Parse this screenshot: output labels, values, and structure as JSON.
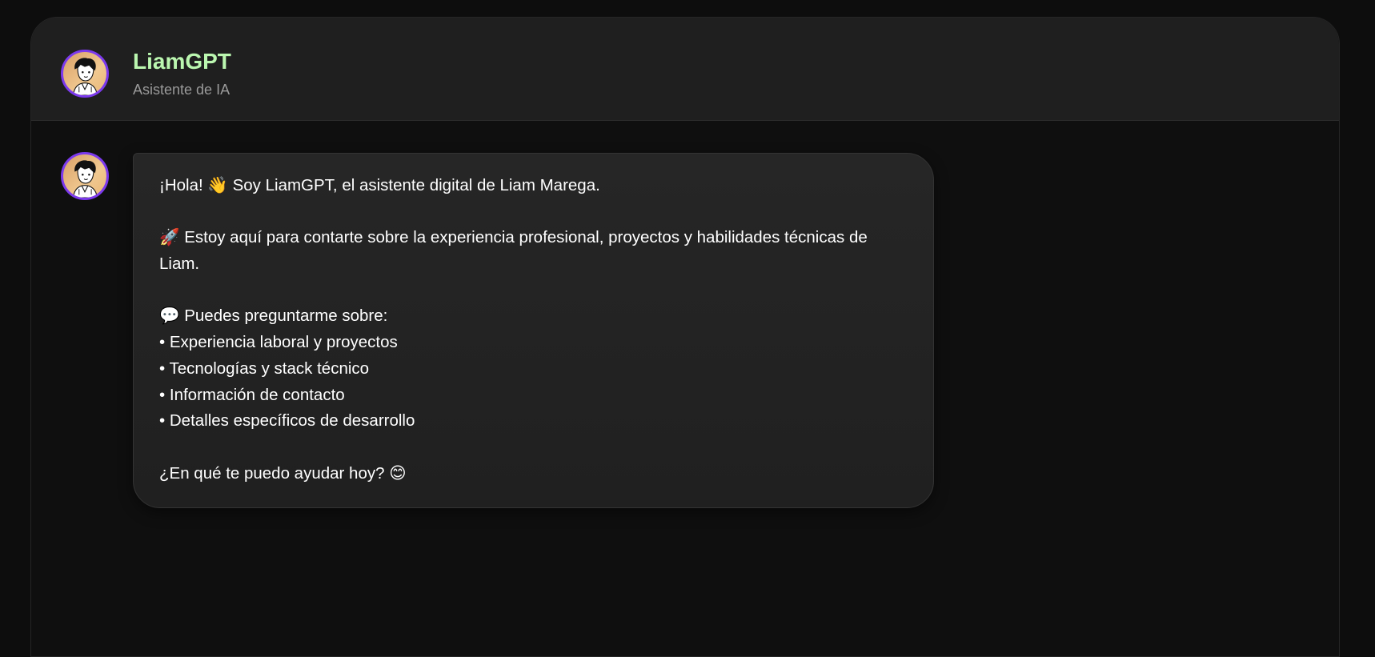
{
  "header": {
    "title": "LiamGPT",
    "subtitle": "Asistente de IA",
    "avatar_icon": "cartoon-avatar-icon"
  },
  "colors": {
    "accent": "#7c3aed",
    "title": "#bbf7b0",
    "background": "#0d0d0d",
    "bubble": "#242424"
  },
  "message": {
    "greeting": "¡Hola! 👋 Soy LiamGPT, el asistente digital de Liam Marega.",
    "intro": "🚀 Estoy aquí para contarte sobre la experiencia profesional, proyectos y habilidades técnicas de Liam.",
    "topics_heading": "💬 Puedes preguntarme sobre:",
    "topics": [
      "• Experiencia laboral y proyectos",
      "• Tecnologías y stack técnico",
      "• Información de contacto",
      "• Detalles específicos de desarrollo"
    ],
    "closing": "¿En qué te puedo ayudar hoy? 😊"
  }
}
